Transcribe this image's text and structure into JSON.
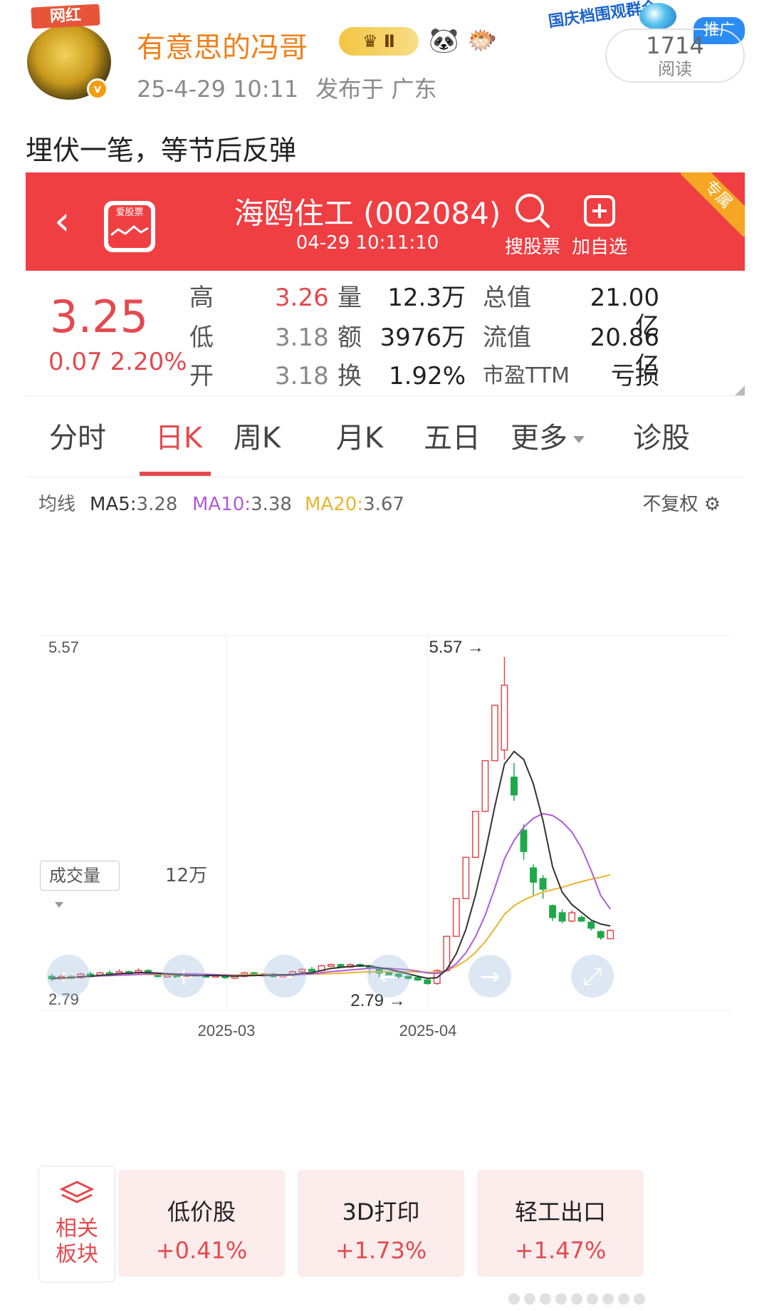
{
  "post": {
    "username": "有意思的冯哥",
    "avatar_badge": "网红",
    "vip_level": "Ⅱ",
    "emojis": [
      "🐼",
      "🐡"
    ],
    "date": "25-4-29 10:11",
    "location": "发布于 广东",
    "festival_banner": "国庆档围观群众",
    "ad_tag": "推广",
    "read_count": "1714",
    "read_label": "阅读",
    "text": "埋伏一笔，等节后反弹"
  },
  "stock": {
    "logo_text": "爱股票",
    "title": "海鸥住工 (002084)",
    "time": "04-29 10:11:10",
    "search_label": "搜股票",
    "add_label": "加自选",
    "exclusive": "专属",
    "price": "3.25",
    "change": "0.07 2.20%",
    "quote": {
      "high_label": "高",
      "high": "3.26",
      "low_label": "低",
      "low": "3.18",
      "open_label": "开",
      "open": "3.18",
      "vol_label": "量",
      "vol": "12.3万",
      "amount_label": "额",
      "amount": "3976万",
      "turnover_label": "换",
      "turnover": "1.92%",
      "mktcap_label": "总值",
      "mktcap": "21.00亿",
      "float_label": "流值",
      "float": "20.86亿",
      "pe_label": "市盈TTM",
      "pe": "亏损"
    },
    "colors": {
      "up": "#e34a4f",
      "down": "#1fa84a",
      "ma5": "#333333",
      "ma10": "#b15bd6",
      "ma20": "#e8b52d",
      "topbar": "#ef3f43"
    }
  },
  "tabs": [
    {
      "label": "分时",
      "active": false
    },
    {
      "label": "日K",
      "active": true
    },
    {
      "label": "周K",
      "active": false
    },
    {
      "label": "月K",
      "active": false
    },
    {
      "label": "五日",
      "active": false
    },
    {
      "label": "更多",
      "active": false
    },
    {
      "label": "诊股",
      "active": false
    }
  ],
  "ma": {
    "title": "均线",
    "ma5_label": "MA5:",
    "ma5": "3.28",
    "ma10_label": "MA10:",
    "ma10": "3.38",
    "ma20_label": "MA20:",
    "ma20": "3.67",
    "adjust": "不复权"
  },
  "chart_data": {
    "type": "candlestick",
    "ylim": [
      2.79,
      5.57
    ],
    "y_max_label": "5.57",
    "y_min_label": "2.79",
    "high_marker": "5.57",
    "low_marker": "2.79",
    "x_tick_labels": [
      "2025-03",
      "2025-04"
    ],
    "volume_max_label": "12万",
    "candles": [
      {
        "o": 2.86,
        "c": 2.84,
        "h": 2.88,
        "l": 2.82,
        "v": 0.3
      },
      {
        "o": 2.84,
        "c": 2.86,
        "h": 2.88,
        "l": 2.83,
        "v": 0.3
      },
      {
        "o": 2.86,
        "c": 2.85,
        "h": 2.87,
        "l": 2.84,
        "v": 0.3
      },
      {
        "o": 2.85,
        "c": 2.88,
        "h": 2.89,
        "l": 2.84,
        "v": 0.3
      },
      {
        "o": 2.88,
        "c": 2.87,
        "h": 2.9,
        "l": 2.86,
        "v": 0.3
      },
      {
        "o": 2.87,
        "c": 2.89,
        "h": 2.9,
        "l": 2.86,
        "v": 0.3
      },
      {
        "o": 2.89,
        "c": 2.88,
        "h": 2.91,
        "l": 2.87,
        "v": 0.3
      },
      {
        "o": 2.88,
        "c": 2.9,
        "h": 2.92,
        "l": 2.87,
        "v": 0.35
      },
      {
        "o": 2.9,
        "c": 2.89,
        "h": 2.91,
        "l": 2.88,
        "v": 0.3
      },
      {
        "o": 2.89,
        "c": 2.91,
        "h": 2.93,
        "l": 2.88,
        "v": 0.35
      },
      {
        "o": 2.91,
        "c": 2.88,
        "h": 2.92,
        "l": 2.87,
        "v": 0.3
      },
      {
        "o": 2.88,
        "c": 2.86,
        "h": 2.89,
        "l": 2.85,
        "v": 0.3
      },
      {
        "o": 2.86,
        "c": 2.87,
        "h": 2.88,
        "l": 2.85,
        "v": 0.3
      },
      {
        "o": 2.87,
        "c": 2.86,
        "h": 2.88,
        "l": 2.85,
        "v": 0.25
      },
      {
        "o": 2.86,
        "c": 2.88,
        "h": 2.89,
        "l": 2.85,
        "v": 0.3
      },
      {
        "o": 2.88,
        "c": 2.87,
        "h": 2.89,
        "l": 2.86,
        "v": 0.25
      },
      {
        "o": 2.87,
        "c": 2.86,
        "h": 2.88,
        "l": 2.85,
        "v": 0.3
      },
      {
        "o": 2.86,
        "c": 2.87,
        "h": 2.88,
        "l": 2.85,
        "v": 0.3
      },
      {
        "o": 2.87,
        "c": 2.85,
        "h": 2.88,
        "l": 2.84,
        "v": 0.3
      },
      {
        "o": 2.85,
        "c": 2.86,
        "h": 2.87,
        "l": 2.84,
        "v": 0.3
      },
      {
        "o": 2.86,
        "c": 2.89,
        "h": 2.9,
        "l": 2.85,
        "v": 0.35
      },
      {
        "o": 2.89,
        "c": 2.87,
        "h": 2.9,
        "l": 2.86,
        "v": 0.3
      },
      {
        "o": 2.87,
        "c": 2.88,
        "h": 2.89,
        "l": 2.86,
        "v": 0.3
      },
      {
        "o": 2.88,
        "c": 2.86,
        "h": 2.89,
        "l": 2.85,
        "v": 0.3
      },
      {
        "o": 2.86,
        "c": 2.87,
        "h": 2.88,
        "l": 2.85,
        "v": 0.25
      },
      {
        "o": 2.87,
        "c": 2.9,
        "h": 2.91,
        "l": 2.86,
        "v": 0.3
      },
      {
        "o": 2.9,
        "c": 2.92,
        "h": 2.93,
        "l": 2.89,
        "v": 0.35
      },
      {
        "o": 2.92,
        "c": 2.91,
        "h": 2.94,
        "l": 2.9,
        "v": 0.3
      },
      {
        "o": 2.91,
        "c": 2.95,
        "h": 2.96,
        "l": 2.9,
        "v": 0.35
      },
      {
        "o": 2.95,
        "c": 2.96,
        "h": 2.97,
        "l": 2.94,
        "v": 0.3
      },
      {
        "o": 2.96,
        "c": 2.94,
        "h": 2.97,
        "l": 2.93,
        "v": 0.3
      },
      {
        "o": 2.94,
        "c": 2.96,
        "h": 2.97,
        "l": 2.93,
        "v": 0.3
      },
      {
        "o": 2.96,
        "c": 2.95,
        "h": 2.97,
        "l": 2.94,
        "v": 0.3
      },
      {
        "o": 2.95,
        "c": 2.93,
        "h": 2.96,
        "l": 2.88,
        "v": 0.3
      },
      {
        "o": 2.93,
        "c": 2.89,
        "h": 2.94,
        "l": 2.85,
        "v": 0.3
      },
      {
        "o": 2.89,
        "c": 2.88,
        "h": 2.9,
        "l": 2.87,
        "v": 0.3
      },
      {
        "o": 2.88,
        "c": 2.86,
        "h": 2.89,
        "l": 2.84,
        "v": 0.3
      },
      {
        "o": 2.86,
        "c": 2.85,
        "h": 2.87,
        "l": 2.83,
        "v": 0.3
      },
      {
        "o": 2.85,
        "c": 2.83,
        "h": 2.86,
        "l": 2.82,
        "v": 0.3
      },
      {
        "o": 2.83,
        "c": 2.8,
        "h": 2.84,
        "l": 2.79,
        "v": 0.3
      },
      {
        "o": 2.8,
        "c": 2.91,
        "h": 2.92,
        "l": 2.79,
        "v": 0.4
      },
      {
        "o": 2.91,
        "c": 3.2,
        "h": 3.2,
        "l": 2.9,
        "v": 2.3
      },
      {
        "o": 3.2,
        "c": 3.52,
        "h": 3.52,
        "l": 3.2,
        "v": 3.8
      },
      {
        "o": 3.52,
        "c": 3.87,
        "h": 3.87,
        "l": 3.52,
        "v": 0.4
      },
      {
        "o": 3.87,
        "c": 4.26,
        "h": 4.26,
        "l": 3.87,
        "v": 0.4
      },
      {
        "o": 4.26,
        "c": 4.69,
        "h": 4.69,
        "l": 4.26,
        "v": 0.4
      },
      {
        "o": 4.69,
        "c": 5.16,
        "h": 5.16,
        "l": 4.69,
        "v": 5.5
      },
      {
        "o": 4.78,
        "c": 5.33,
        "h": 5.57,
        "l": 4.7,
        "v": 7.9
      },
      {
        "o": 4.55,
        "c": 4.4,
        "h": 4.67,
        "l": 4.35,
        "v": 6.5
      },
      {
        "o": 4.1,
        "c": 3.92,
        "h": 4.15,
        "l": 3.85,
        "v": 4.8
      },
      {
        "o": 3.78,
        "c": 3.66,
        "h": 3.81,
        "l": 3.55,
        "v": 4.6
      },
      {
        "o": 3.69,
        "c": 3.6,
        "h": 3.72,
        "l": 3.52,
        "v": 4.2
      },
      {
        "o": 3.46,
        "c": 3.36,
        "h": 3.47,
        "l": 3.33,
        "v": 3.3
      },
      {
        "o": 3.4,
        "c": 3.33,
        "h": 3.43,
        "l": 3.31,
        "v": 2.9
      },
      {
        "o": 3.33,
        "c": 3.4,
        "h": 3.42,
        "l": 3.32,
        "v": 2.5
      },
      {
        "o": 3.36,
        "c": 3.33,
        "h": 3.38,
        "l": 3.32,
        "v": 2.5
      },
      {
        "o": 3.32,
        "c": 3.27,
        "h": 3.33,
        "l": 3.25,
        "v": 2.3
      },
      {
        "o": 3.24,
        "c": 3.19,
        "h": 3.25,
        "l": 3.17,
        "v": 2.0
      },
      {
        "o": 3.18,
        "c": 3.25,
        "h": 3.26,
        "l": 3.18,
        "v": 0.5
      }
    ]
  },
  "volume": {
    "selector_label": "成交量",
    "max_label": "12万"
  },
  "related": {
    "label_line1": "相关",
    "label_line2": "板块",
    "sectors": [
      {
        "name": "低价股",
        "change": "+0.41%"
      },
      {
        "name": "3D打印",
        "change": "+1.73%"
      },
      {
        "name": "轻工出口",
        "change": "+1.47%"
      }
    ]
  }
}
